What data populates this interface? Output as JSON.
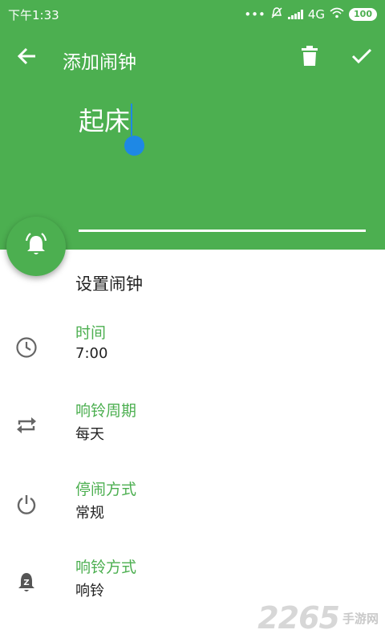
{
  "status_bar": {
    "time": "下午1:33",
    "dots": "•••",
    "network": "4G",
    "battery": "100"
  },
  "toolbar": {
    "title": "添加闹钟"
  },
  "alarm_name": {
    "value": "起床"
  },
  "section": {
    "title": "设置闹钟"
  },
  "settings": [
    {
      "label": "时间",
      "value": "7:00",
      "icon": "clock-icon"
    },
    {
      "label": "响铃周期",
      "value": "每天",
      "icon": "repeat-icon"
    },
    {
      "label": "停闹方式",
      "value": "常规",
      "icon": "power-icon"
    },
    {
      "label": "响铃方式",
      "value": "响铃",
      "icon": "bell-z-icon"
    }
  ],
  "watermark": {
    "number": "2265",
    "text": "手游网"
  },
  "colors": {
    "accent": "#4caf50",
    "cursor": "#1e88e5"
  }
}
